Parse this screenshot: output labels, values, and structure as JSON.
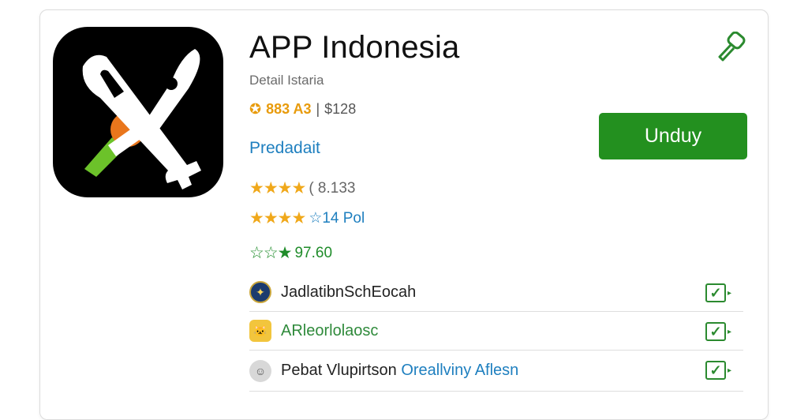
{
  "app": {
    "title": "APP Indonesia",
    "subtitle": "Detail Istaria",
    "meta_badge": "883 A3",
    "meta_sep": "|",
    "meta_price": "$128",
    "developer": "Predadait"
  },
  "ratings": [
    {
      "stars": "★★★★",
      "value": "( 8.133"
    },
    {
      "stars": "★★★★",
      "value": "☆14 Pol"
    },
    {
      "stars": "☆☆★",
      "value": "97.60"
    }
  ],
  "download_button": {
    "label": "Unduy"
  },
  "permissions": [
    {
      "label": "JadlatibnSchEocah",
      "icon": "globe-icon"
    },
    {
      "label": "ARleorlolaosc",
      "icon": "cat-icon"
    },
    {
      "label_a": "Pebat Vlupirtson ",
      "label_b": "Oreallviny Aflesn",
      "icon": "avatar-icon"
    }
  ],
  "colors": {
    "accent_green": "#23901f",
    "link_blue": "#1e7fbf",
    "star_yellow": "#f0a81a"
  }
}
